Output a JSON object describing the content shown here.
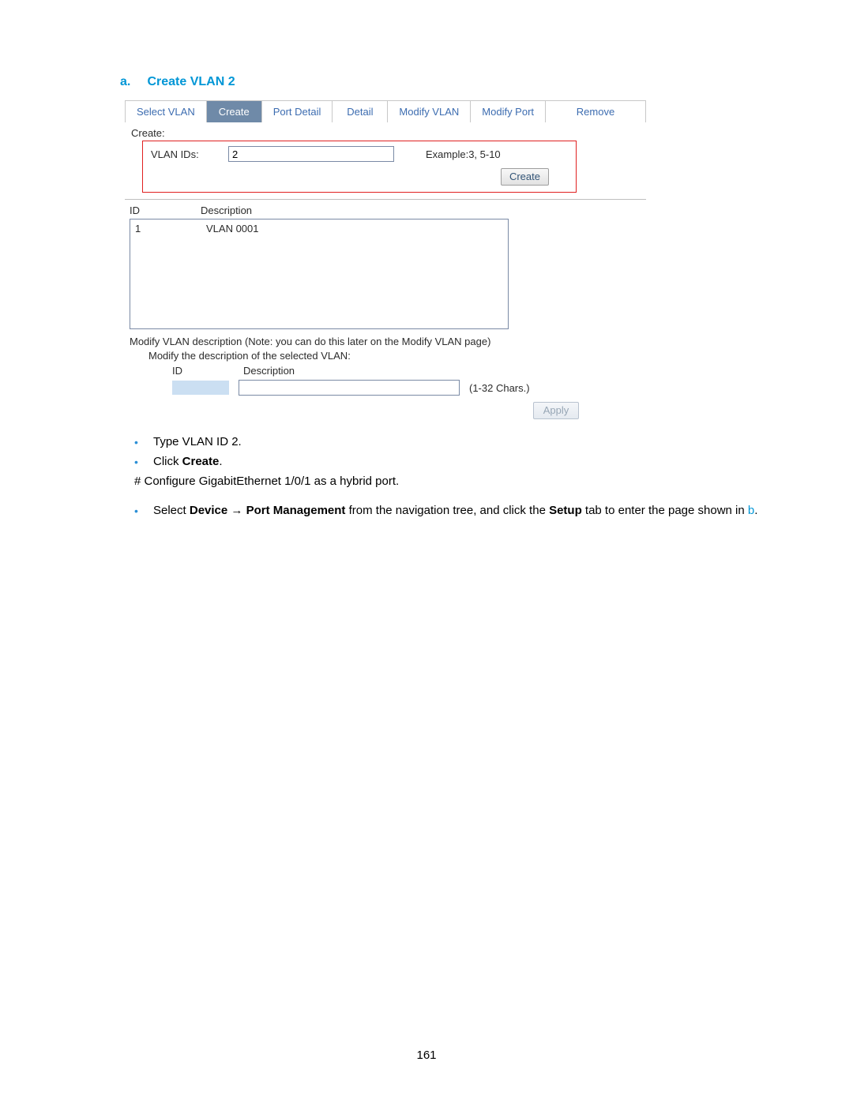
{
  "heading": {
    "item_letter": "a.",
    "title": "Create VLAN 2"
  },
  "tabs": {
    "select_vlan": "Select VLAN",
    "create": "Create",
    "port_detail": "Port Detail",
    "detail": "Detail",
    "modify_vlan": "Modify VLAN",
    "modify_port": "Modify Port",
    "remove": "Remove"
  },
  "create_section": {
    "label": "Create:",
    "vlan_ids_label": "VLAN IDs:",
    "vlan_ids_value": "2",
    "example": "Example:3, 5-10",
    "create_button": "Create"
  },
  "id_table": {
    "col_id": "ID",
    "col_desc": "Description",
    "rows": [
      {
        "id": "1",
        "desc": "VLAN 0001"
      }
    ]
  },
  "modify_section": {
    "note": "Modify VLAN description (Note: you can do this later on the Modify VLAN page)",
    "sub": "Modify the description of the selected VLAN:",
    "col_id": "ID",
    "col_desc": "Description",
    "hint": "(1-32 Chars.)",
    "apply_button": "Apply"
  },
  "instructions": {
    "bullet1_prefix": "Type VLAN ID ",
    "bullet1_value": "2.",
    "bullet2_prefix": "Click ",
    "bullet2_bold": "Create",
    "bullet2_suffix": ".",
    "hash_line": "# Configure GigabitEthernet 1/0/1 as a hybrid port.",
    "bullet3_prefix": "Select ",
    "bullet3_device": "Device",
    "bullet3_arrow": " → ",
    "bullet3_pm": "Port Management",
    "bullet3_mid": " from the navigation tree, and click the ",
    "bullet3_setup": "Setup",
    "bullet3_after": " tab to enter the page shown in ",
    "bullet3_link": "b",
    "bullet3_end": "."
  },
  "page_number": "161"
}
